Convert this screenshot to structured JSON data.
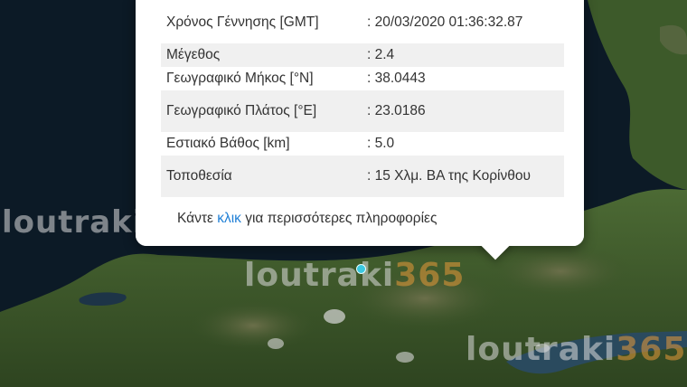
{
  "popup": {
    "rows": [
      {
        "label": "Χρόνος Γέννησης [GMT]",
        "value": ": 20/03/2020 01:36:32.87"
      },
      {
        "label": "Μέγεθος",
        "value": ": 2.4"
      },
      {
        "label": "Γεωγραφικό Μήκος [°N]",
        "value": ": 38.0443"
      },
      {
        "label": "Γεωγραφικό Πλάτος [°E]",
        "value": ": 23.0186"
      },
      {
        "label": "Εστιακό Βάθος [km]",
        "value": ": 5.0"
      },
      {
        "label": "Τοποθεσία",
        "value": ": 15 Χλμ. ΒΑ της Κορίνθου"
      }
    ],
    "more_prefix": "Κάντε ",
    "more_link": "κλικ",
    "more_suffix": " για περισσότερες πληροφορίες"
  },
  "watermark": {
    "part1": "loutraki",
    "part2": "365"
  },
  "colors": {
    "sea": "#0c1a26",
    "land": "#3f5a2c",
    "link": "#1f7fd6",
    "marker": "#3bc8e0",
    "watermark_accent": "#e89a3a"
  }
}
